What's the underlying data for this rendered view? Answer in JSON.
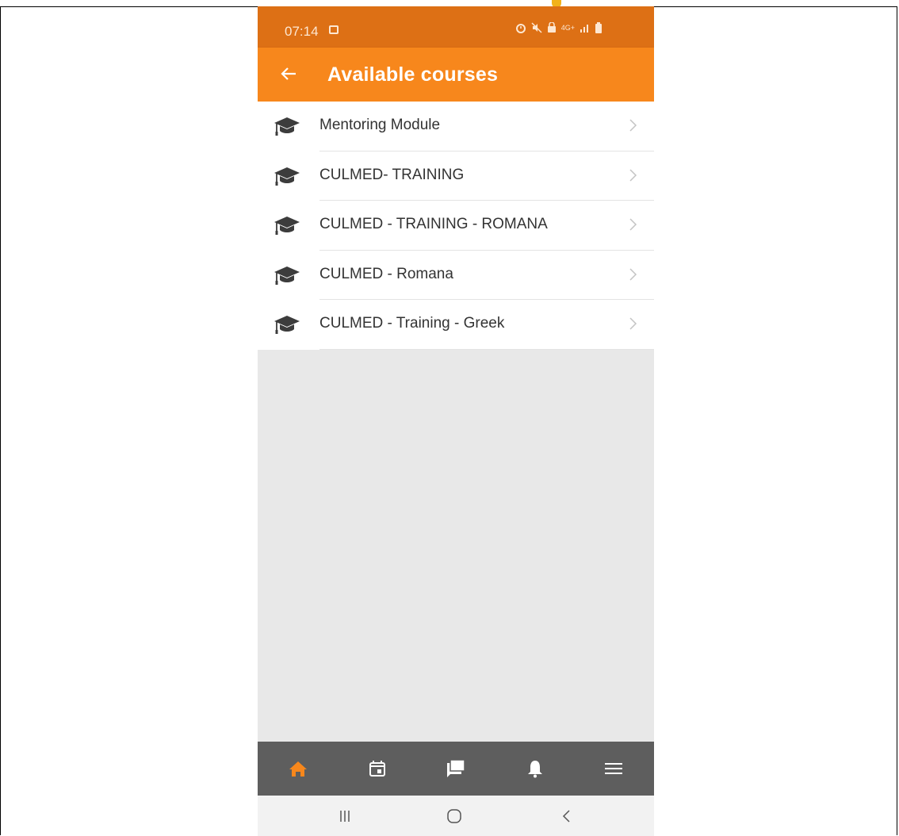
{
  "status_bar": {
    "time": "07:14",
    "right_icons": [
      "alarm-icon",
      "mute-icon",
      "lock-icon",
      "4g-signal-icon",
      "battery-icon"
    ],
    "network_label": "4G+"
  },
  "app_bar": {
    "title": "Available courses",
    "back_icon": "arrow-left-icon"
  },
  "courses": [
    {
      "label": "Mentoring Module"
    },
    {
      "label": "CULMED- TRAINING"
    },
    {
      "label": "CULMED - TRAINING - ROMANA"
    },
    {
      "label": "CULMED - Romana"
    },
    {
      "label": "CULMED - Training - Greek"
    }
  ],
  "bottom_nav": {
    "items": [
      "home-icon",
      "calendar-icon",
      "messages-icon",
      "notifications-icon",
      "menu-icon"
    ],
    "active": "home-icon"
  },
  "colors": {
    "status_bar": "#dd7015",
    "app_bar": "#f7871c",
    "accent": "#f7871c",
    "bottom_nav": "#5e5e5e",
    "background": "#e8e8e8"
  }
}
